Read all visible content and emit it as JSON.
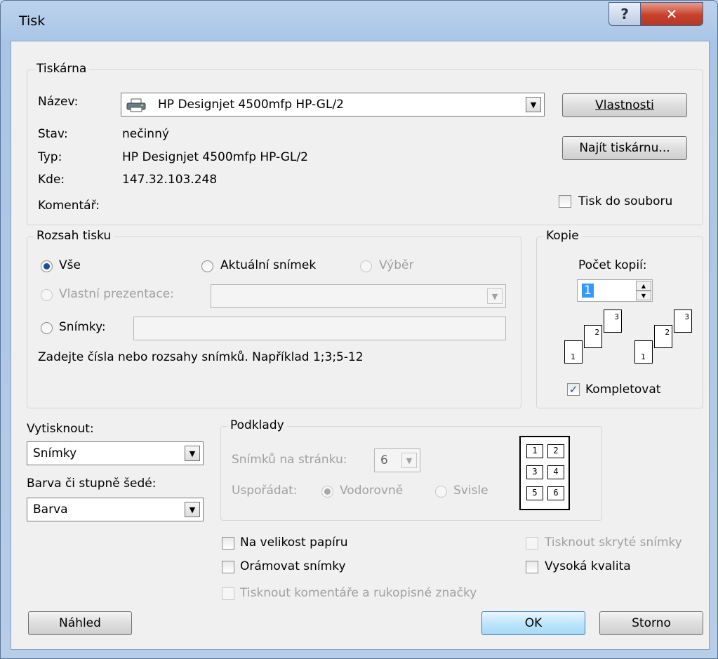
{
  "window": {
    "title": "Tisk"
  },
  "printer": {
    "group_label": "Tiskárna",
    "name_label": "Název:",
    "name_value": "HP Designjet 4500mfp HP-GL/2",
    "status_label": "Stav:",
    "status_value": "nečinný",
    "type_label": "Typ:",
    "type_value": "HP Designjet 4500mfp HP-GL/2",
    "where_label": "Kde:",
    "where_value": "147.32.103.248",
    "comment_label": "Komentář:",
    "properties_button": "Vlastnosti",
    "find_button": "Najít tiskárnu...",
    "print_to_file": "Tisk do souboru"
  },
  "range": {
    "group_label": "Rozsah tisku",
    "all": "Vše",
    "current": "Aktuální snímek",
    "selection": "Výběr",
    "custom": "Vlastní prezentace:",
    "slides": "Snímky:",
    "hint": "Zadejte čísla nebo rozsahy snímků. Například 1;3;5-12"
  },
  "copies": {
    "group_label": "Kopie",
    "count_label": "Počet kopií:",
    "count_value": "1",
    "collate": "Kompletovat",
    "icon_pages": [
      "1",
      "2",
      "3"
    ]
  },
  "print_what": {
    "label": "Vytisknout:",
    "value": "Snímky",
    "color_label": "Barva či stupně šedé:",
    "color_value": "Barva"
  },
  "handouts": {
    "group_label": "Podklady",
    "per_page_label": "Snímků na stránku:",
    "per_page_value": "6",
    "order_label": "Uspořádat:",
    "horizontal": "Vodorovně",
    "vertical": "Svisle",
    "preview_cells": [
      "1",
      "2",
      "3",
      "4",
      "5",
      "6"
    ]
  },
  "options": {
    "scale_to_fit": "Na velikost papíru",
    "frame_slides": "Orámovat snímky",
    "print_comments": "Tisknout komentáře a rukopisné značky",
    "print_hidden": "Tisknout skryté snímky",
    "high_quality": "Vysoká kvalita"
  },
  "buttons": {
    "preview": "Náhled",
    "ok": "OK",
    "cancel": "Storno"
  }
}
